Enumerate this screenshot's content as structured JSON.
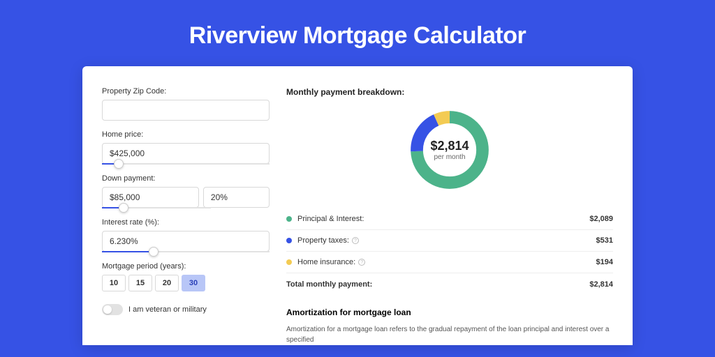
{
  "title": "Riverview Mortgage Calculator",
  "colors": {
    "green": "#4cb38a",
    "blue": "#3652e5",
    "yellow": "#f3cb53"
  },
  "form": {
    "zip": {
      "label": "Property Zip Code:",
      "value": ""
    },
    "home_price": {
      "label": "Home price:",
      "value": "$425,000",
      "slider_pct": 10
    },
    "down_payment": {
      "label": "Down payment:",
      "value": "$85,000",
      "pct_value": "20%",
      "slider_pct": 20
    },
    "interest": {
      "label": "Interest rate (%):",
      "value": "6.230%",
      "slider_pct": 31
    },
    "period": {
      "label": "Mortgage period (years):",
      "options": [
        "10",
        "15",
        "20",
        "30"
      ],
      "selected": "30"
    },
    "veteran": {
      "label": "I am veteran or military",
      "on": false
    }
  },
  "breakdown": {
    "title": "Monthly payment breakdown:",
    "center_amount": "$2,814",
    "center_sub": "per month",
    "items": [
      {
        "label": "Principal & Interest:",
        "value": "$2,089",
        "color": "#4cb38a",
        "info": false
      },
      {
        "label": "Property taxes:",
        "value": "$531",
        "color": "#3652e5",
        "info": true
      },
      {
        "label": "Home insurance:",
        "value": "$194",
        "color": "#f3cb53",
        "info": true
      }
    ],
    "total": {
      "label": "Total monthly payment:",
      "value": "$2,814"
    }
  },
  "amort": {
    "title": "Amortization for mortgage loan",
    "text": "Amortization for a mortgage loan refers to the gradual repayment of the loan principal and interest over a specified"
  },
  "chart_data": {
    "type": "pie",
    "title": "Monthly payment breakdown",
    "total": 2814,
    "series": [
      {
        "name": "Principal & Interest",
        "value": 2089,
        "color": "#4cb38a"
      },
      {
        "name": "Property taxes",
        "value": 531,
        "color": "#3652e5"
      },
      {
        "name": "Home insurance",
        "value": 194,
        "color": "#f3cb53"
      }
    ]
  }
}
